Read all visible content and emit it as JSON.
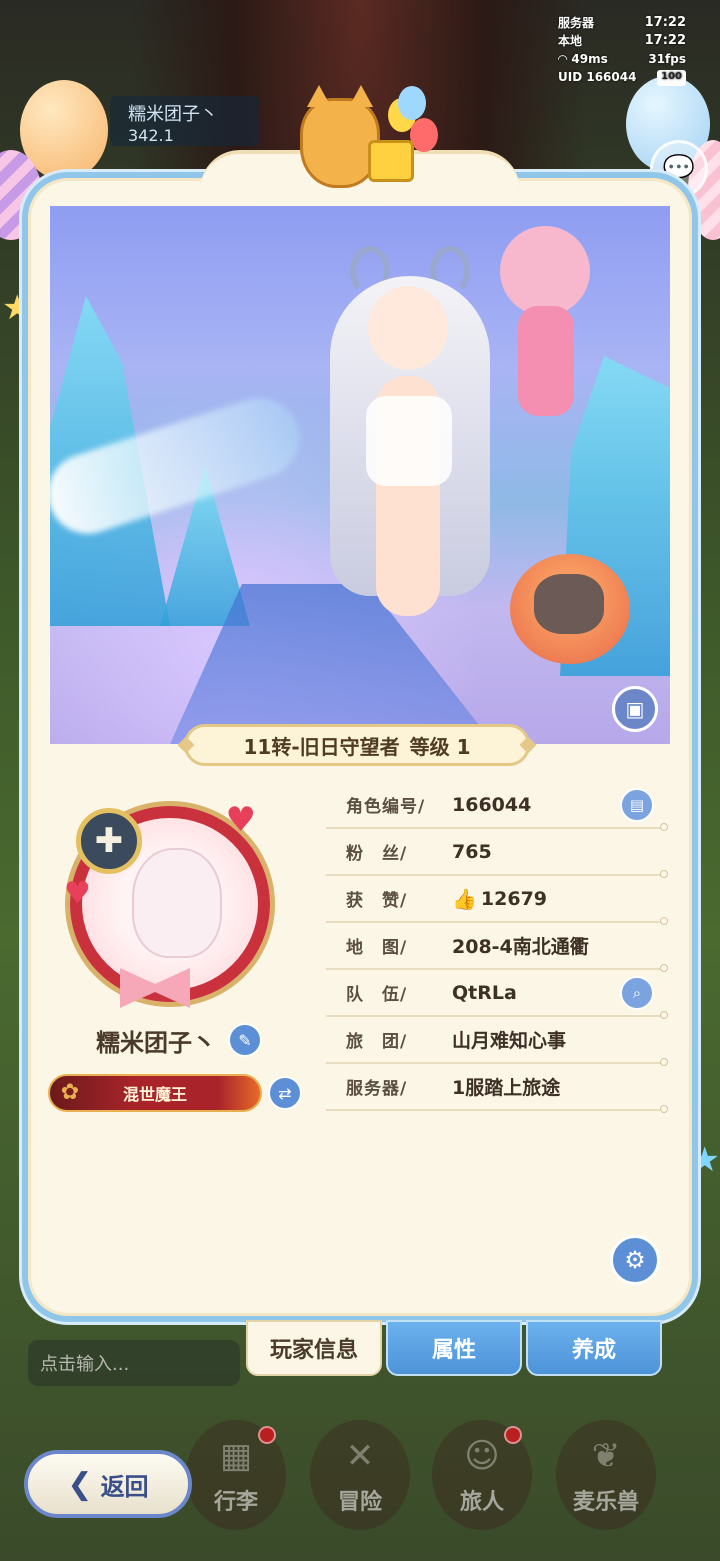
{
  "status": {
    "server_label": "服务器",
    "server_time": "17:22",
    "local_label": "本地",
    "local_time": "17:22",
    "ping": "49ms",
    "fps": "31fps",
    "uid": "UID 166044",
    "battery": "100"
  },
  "background": {
    "name_line1": "糯米团子丶",
    "name_line2": "342.1"
  },
  "profile": {
    "class_title": "11转-旧日守望者",
    "level_label": "等级 1",
    "player_name": "糯米团子丶",
    "title_badge": "混世魔王"
  },
  "info_rows": [
    {
      "label": "角色编号/",
      "value": "166044"
    },
    {
      "label": "粉　丝/",
      "value": "765"
    },
    {
      "label": "获　赞/",
      "value": "12679"
    },
    {
      "label": "地　图/",
      "value": "208-4南北通衢"
    },
    {
      "label": "队　伍/",
      "value": "QtRLa"
    },
    {
      "label": "旅　团/",
      "value": "山月难知心事"
    },
    {
      "label": "服务器/",
      "value": "1服踏上旅途"
    }
  ],
  "tabs": [
    {
      "label": "玩家信息",
      "active": true
    },
    {
      "label": "属性",
      "active": false
    },
    {
      "label": "养成",
      "active": false
    }
  ],
  "chat": {
    "placeholder": "点击输入..."
  },
  "bottom_nav": [
    {
      "label": "行李",
      "icon": "bag-icon",
      "badge": true
    },
    {
      "label": "冒险",
      "icon": "swords-icon",
      "badge": false
    },
    {
      "label": "旅人",
      "icon": "traveler-icon",
      "badge": true
    },
    {
      "label": "麦乐兽",
      "icon": "pet-icon",
      "badge": false
    }
  ],
  "back": {
    "label": "返回"
  },
  "colors": {
    "panel_border": "#8fc6ea",
    "panel_bg": "#fbf6e6",
    "accent_blue": "#5c8fd6",
    "title_red": "#a8242a"
  }
}
